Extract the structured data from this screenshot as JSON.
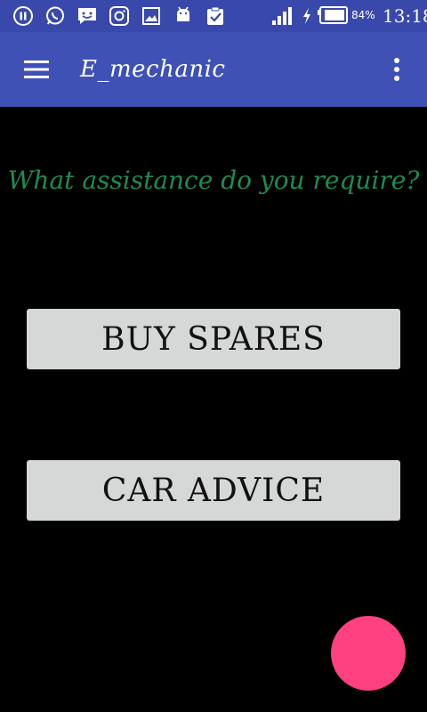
{
  "status_bar": {
    "battery_percent": "84%",
    "time": "13:18",
    "icons": [
      "pause-icon",
      "whatsapp-icon",
      "messenger-icon",
      "instagram-icon",
      "gallery-icon",
      "android-icon",
      "clipboard-check-icon",
      "signal-icon",
      "charging-icon",
      "battery-icon"
    ]
  },
  "app_bar": {
    "title": "E_mechanic",
    "background": "#3f51b5"
  },
  "main": {
    "question": "What assistance do you require?",
    "question_color": "#1e8c4f",
    "buttons": [
      {
        "label": "BUY SPARES"
      },
      {
        "label": "CAR ADVICE"
      }
    ]
  },
  "fab": {
    "color": "#ff4081"
  }
}
